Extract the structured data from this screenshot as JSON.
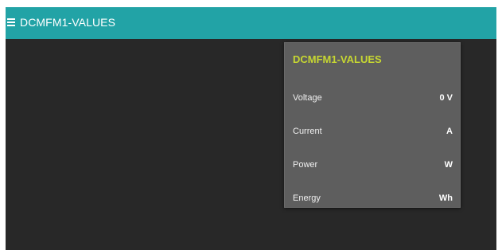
{
  "header": {
    "title": "DCMFM1-VALUES",
    "menu_icon": "hamburger-menu-icon",
    "bar_color": "#22a3a6"
  },
  "panel": {
    "title": "DCMFM1-VALUES",
    "title_color": "#c6d632",
    "rows": [
      {
        "label": "Voltage",
        "value": "0",
        "unit": "V"
      },
      {
        "label": "Current",
        "value": "",
        "unit": "A"
      },
      {
        "label": "Power",
        "value": "",
        "unit": "W"
      },
      {
        "label": "Energy",
        "value": "",
        "unit": "Wh"
      }
    ]
  }
}
